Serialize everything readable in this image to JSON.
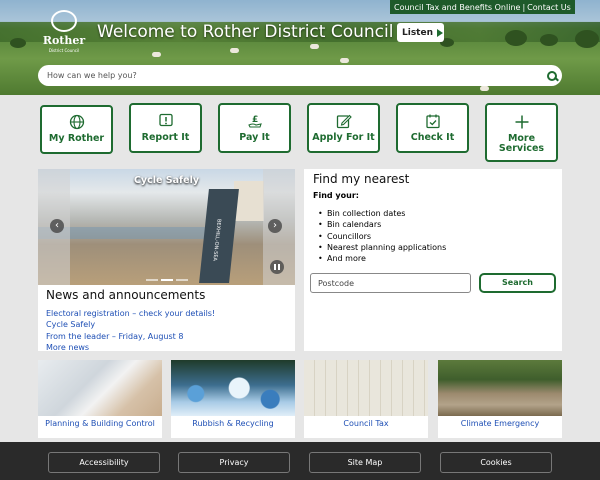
{
  "header": {
    "logo_name": "Rother",
    "logo_sub": "District Council",
    "welcome": "Welcome to Rother District Council",
    "listen_label": "Listen",
    "top_links": [
      "Council Tax and Benefits Online",
      "Contact Us"
    ],
    "search_placeholder": "How can we help you?"
  },
  "quick_links": [
    {
      "label": "My Rother",
      "icon": "globe-icon"
    },
    {
      "label": "Report It",
      "icon": "alert-icon"
    },
    {
      "label": "Pay It",
      "icon": "pound-hand-icon"
    },
    {
      "label": "Apply For It",
      "icon": "edit-icon"
    },
    {
      "label": "Check It",
      "icon": "calendar-check-icon"
    },
    {
      "label": "More Services",
      "icon": "plus-icon"
    }
  ],
  "carousel": {
    "slide_title": "Cycle Safely",
    "sign_text": "BEXHILL-ON-SEA"
  },
  "news": {
    "heading": "News and announcements",
    "items": [
      "Electoral registration – check your details!",
      "Cycle Safely",
      "From the leader – Friday, August 8",
      "More news"
    ]
  },
  "find_nearest": {
    "heading": "Find my nearest",
    "subheading": "Find your:",
    "items": [
      "Bin collection dates",
      "Bin calendars",
      "Councillors",
      "Nearest planning applications",
      "And more"
    ],
    "postcode_placeholder": "Postcode",
    "search_label": "Search"
  },
  "tiles": [
    {
      "label": "Planning & Building Control"
    },
    {
      "label": "Rubbish & Recycling"
    },
    {
      "label": "Council Tax"
    },
    {
      "label": "Climate Emergency"
    }
  ],
  "footer": {
    "buttons": [
      "Accessibility",
      "Privacy",
      "Site Map",
      "Cookies"
    ]
  },
  "colors": {
    "brand_green": "#1e6b30",
    "link_blue": "#1e4fb5",
    "footer_bg": "#2a2a2a"
  }
}
